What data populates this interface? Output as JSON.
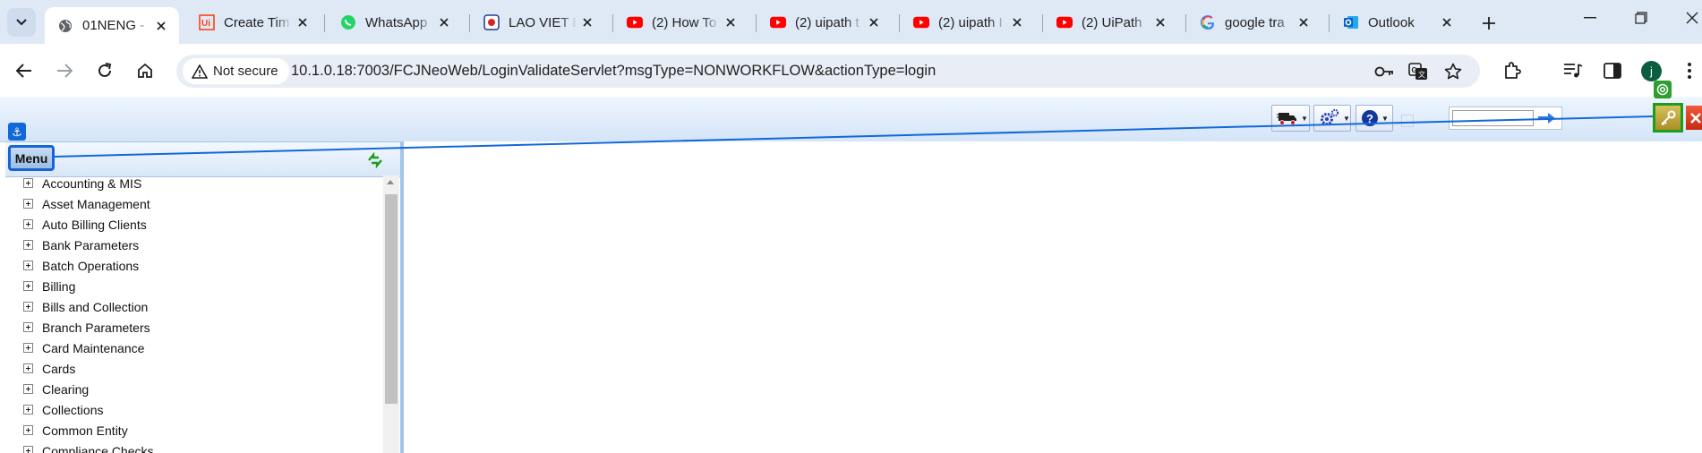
{
  "browser": {
    "tabs": [
      {
        "title": "01NENG -",
        "icon": "globe-icon",
        "active": true
      },
      {
        "title": "Create Tim",
        "icon": "uipath-icon",
        "active": false
      },
      {
        "title": "WhatsApp",
        "icon": "whatsapp-icon",
        "active": false
      },
      {
        "title": "LAO VIET E",
        "icon": "bank-logo-icon",
        "active": false
      },
      {
        "title": "(2) How To",
        "icon": "youtube-icon",
        "active": false
      },
      {
        "title": "(2) uipath t",
        "icon": "youtube-icon",
        "active": false
      },
      {
        "title": "(2) uipath I",
        "icon": "youtube-icon",
        "active": false
      },
      {
        "title": "(2) UiPath",
        "icon": "youtube-icon",
        "active": false
      },
      {
        "title": "google tra",
        "icon": "google-icon",
        "active": false
      },
      {
        "title": "Outlook",
        "icon": "outlook-icon",
        "active": false
      }
    ],
    "security_label": "Not secure",
    "url": "10.1.0.18:7003/FCJNeoWeb/LoginValidateServlet?msgType=NONWORKFLOW&actionType=login",
    "profile_initial": "j"
  },
  "app": {
    "quick_search_value": "",
    "menu_title": "Menu",
    "menu_items": [
      "Accounting & MIS",
      "Asset Management",
      "Auto Billing Clients",
      "Bank Parameters",
      "Batch Operations",
      "Billing",
      "Bills and Collection",
      "Branch Parameters",
      "Card Maintenance",
      "Cards",
      "Clearing",
      "Collections",
      "Common Entity",
      "Compliance Checks"
    ]
  },
  "colors": {
    "tabstrip_bg": "#dfe9f6",
    "omnibox_bg": "#e9eef6",
    "header_gradient_top": "#eef5fd",
    "header_gradient_bottom": "#d4e5f8",
    "annotation_blue": "#1368d8",
    "annotation_green": "#1c9e1c",
    "youtube_red": "#ff0000",
    "uipath_orange": "#fa4616",
    "whatsapp_green": "#25d366",
    "outlook_blue": "#0a64c8"
  }
}
